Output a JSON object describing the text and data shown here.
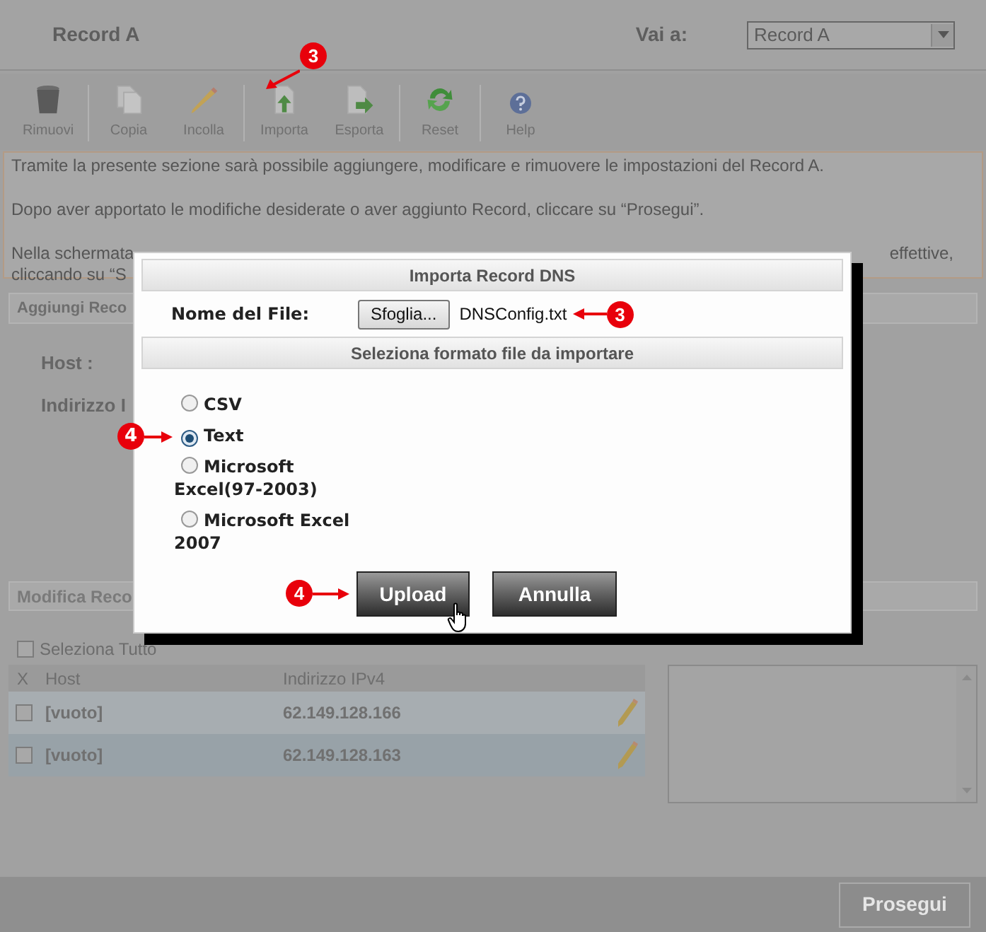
{
  "header": {
    "title": "Record A",
    "goto_label": "Vai a:",
    "goto_value": "Record A"
  },
  "toolbar": [
    [
      {
        "label": "Rimuovi",
        "kind": "trash"
      }
    ],
    [
      {
        "label": "Copia",
        "kind": "copy"
      },
      {
        "label": "Incolla",
        "kind": "pencil"
      }
    ],
    [
      {
        "label": "Importa",
        "kind": "import",
        "annotation": "3"
      },
      {
        "label": "Esporta",
        "kind": "export"
      }
    ],
    [
      {
        "label": "Reset",
        "kind": "reset"
      }
    ],
    [
      {
        "label": "Help",
        "kind": "help"
      }
    ]
  ],
  "info": {
    "paragraphs": [
      "Tramite la presente sezione sarà possibile aggiungere, modificare e rimuovere le impostazioni del Record A.",
      "Dopo aver apportato le modifiche desiderate o aver aggiunto Record, cliccare su “Prosegui”."
    ],
    "covered_line_left": "Nella schermata",
    "covered_line_right": "effettive,",
    "covered_line_2": "cliccando su “S"
  },
  "add_section": {
    "title": "Aggiungi Reco",
    "fields": [
      "Host :",
      "Indirizzo I"
    ]
  },
  "edit_section": {
    "title": "Modifica Reco",
    "select_all": {
      "label": "Seleziona Tutto",
      "checked": false
    },
    "columns": [
      "X",
      "Host",
      "Indirizzo IPv4"
    ],
    "rows": [
      {
        "host": "[vuoto]",
        "ip": "62.149.128.166",
        "checked": false
      },
      {
        "host": "[vuoto]",
        "ip": "62.149.128.163",
        "checked": false
      }
    ]
  },
  "footer": {
    "button": "Prosegui"
  },
  "dialog": {
    "title": "Importa Record DNS",
    "file_label": "Nome del File:",
    "browse_button": "Sfoglia...",
    "file_name": "DNSConfig.txt",
    "file_annotation": "3",
    "format_title": "Seleziona formato file da importare",
    "formats": [
      {
        "label": "CSV",
        "selected": false
      },
      {
        "label": "Text",
        "selected": true,
        "annotation": "4"
      },
      {
        "label": "Microsoft Excel(97-2003)",
        "selected": false
      },
      {
        "label": "Microsoft Excel 2007",
        "selected": false
      }
    ],
    "buttons": [
      {
        "label": "Upload",
        "annotation": "4"
      },
      {
        "label": "Annulla"
      }
    ]
  }
}
